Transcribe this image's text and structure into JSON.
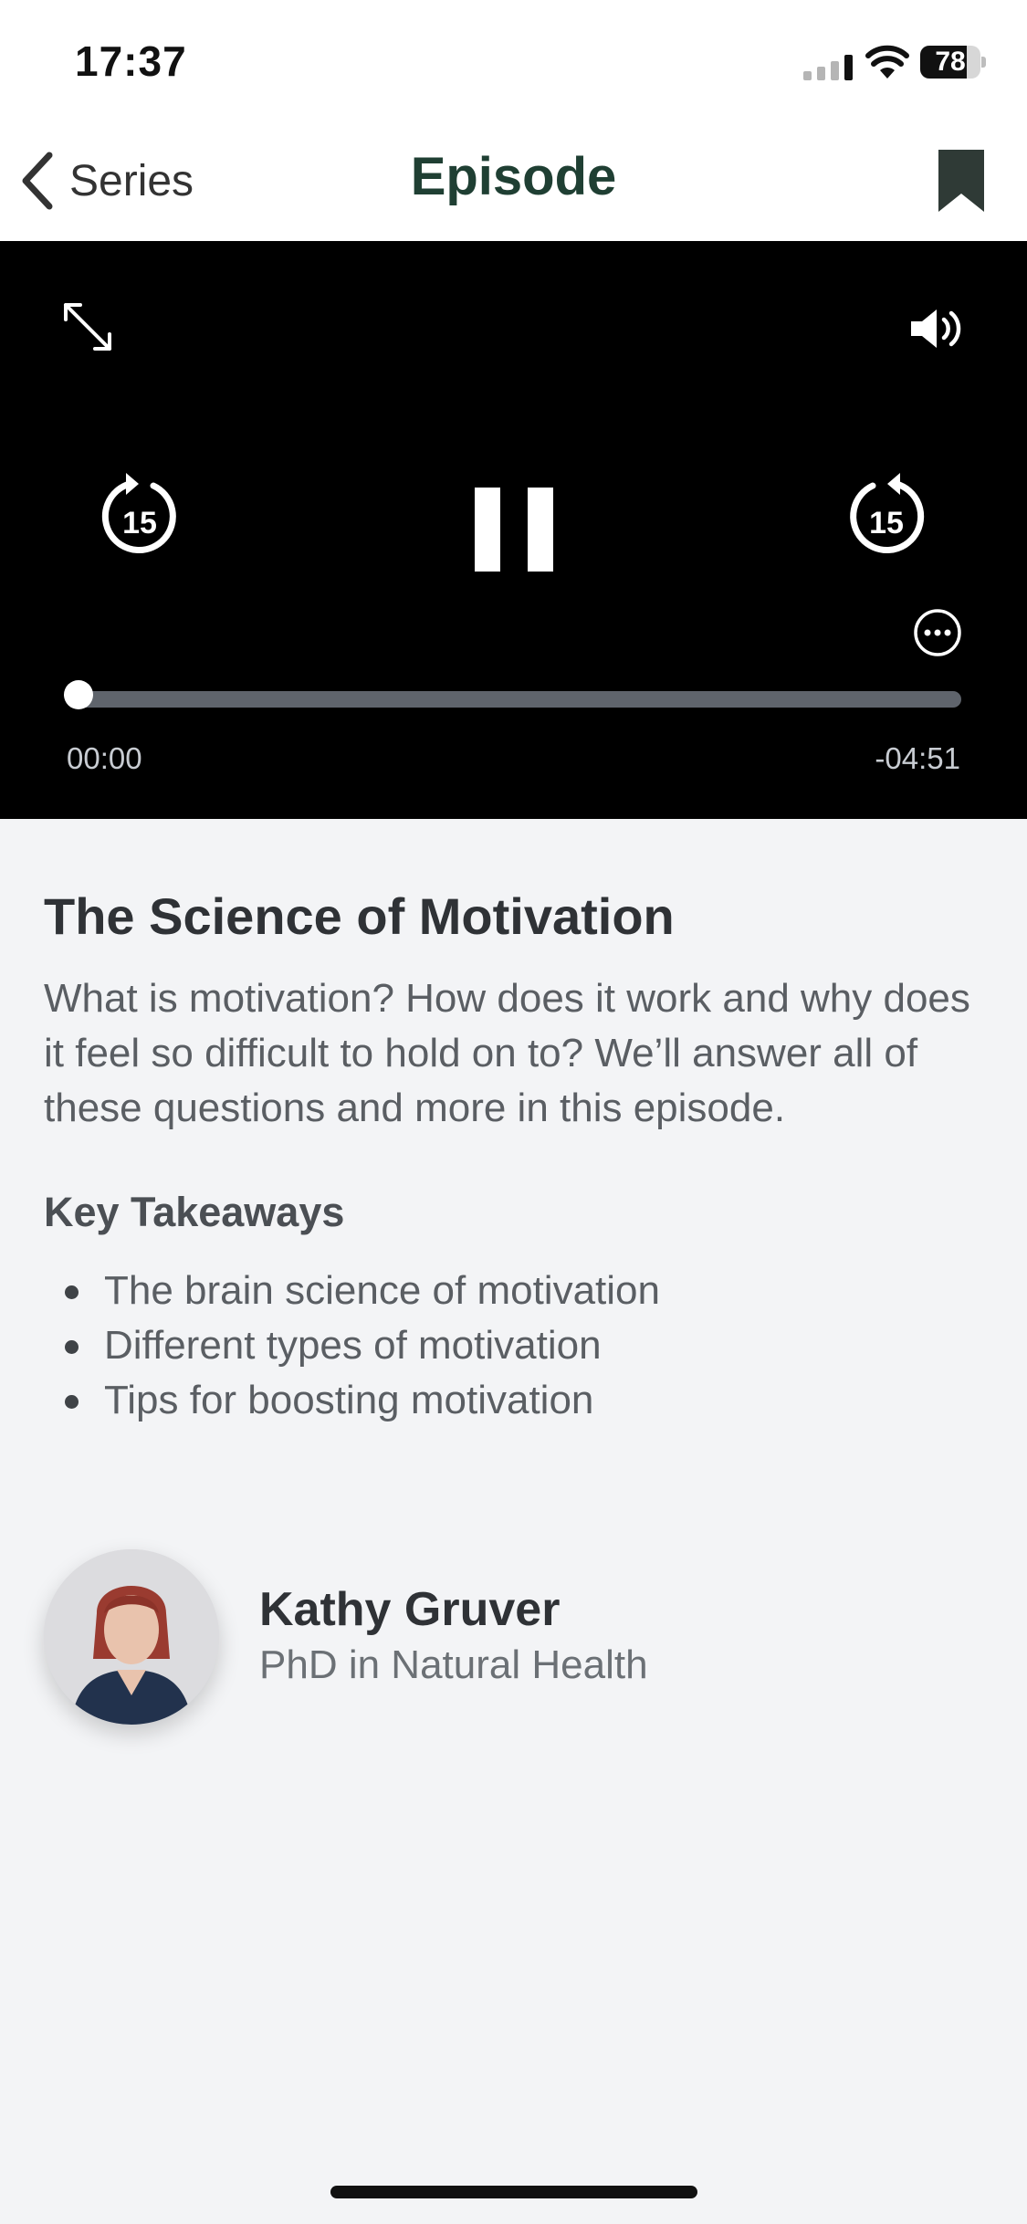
{
  "status_bar": {
    "time": "17:37",
    "battery_percent": "78",
    "battery_level": 0.78
  },
  "nav": {
    "back_label": "Series",
    "title": "Episode"
  },
  "player": {
    "state": "playing",
    "skip_back_seconds": "15",
    "skip_forward_seconds": "15",
    "elapsed": "00:00",
    "remaining": "-04:51",
    "progress_fraction": 0.0
  },
  "episode": {
    "title": "The Science of Motivation",
    "description": "What is motivation? How does it work and why does it feel so difficult to hold on to? We’ll answer all of these questions and more in this episode.",
    "key_takeaways_heading": "Key Takeaways",
    "key_takeaways": [
      "The brain science of motivation",
      "Different types of motivation",
      "Tips for boosting motivation"
    ]
  },
  "author": {
    "name": "Kathy Gruver",
    "credential": "PhD in Natural Health"
  },
  "colors": {
    "nav_title": "#1f3f33",
    "player_bg": "#000000",
    "page_bg": "#f3f4f6",
    "track": "#5f646c"
  },
  "icons": [
    "back-chevron-icon",
    "bookmark-icon",
    "expand-icon",
    "volume-icon",
    "rewind-15-icon",
    "pause-icon",
    "forward-15-icon",
    "more-icon"
  ]
}
